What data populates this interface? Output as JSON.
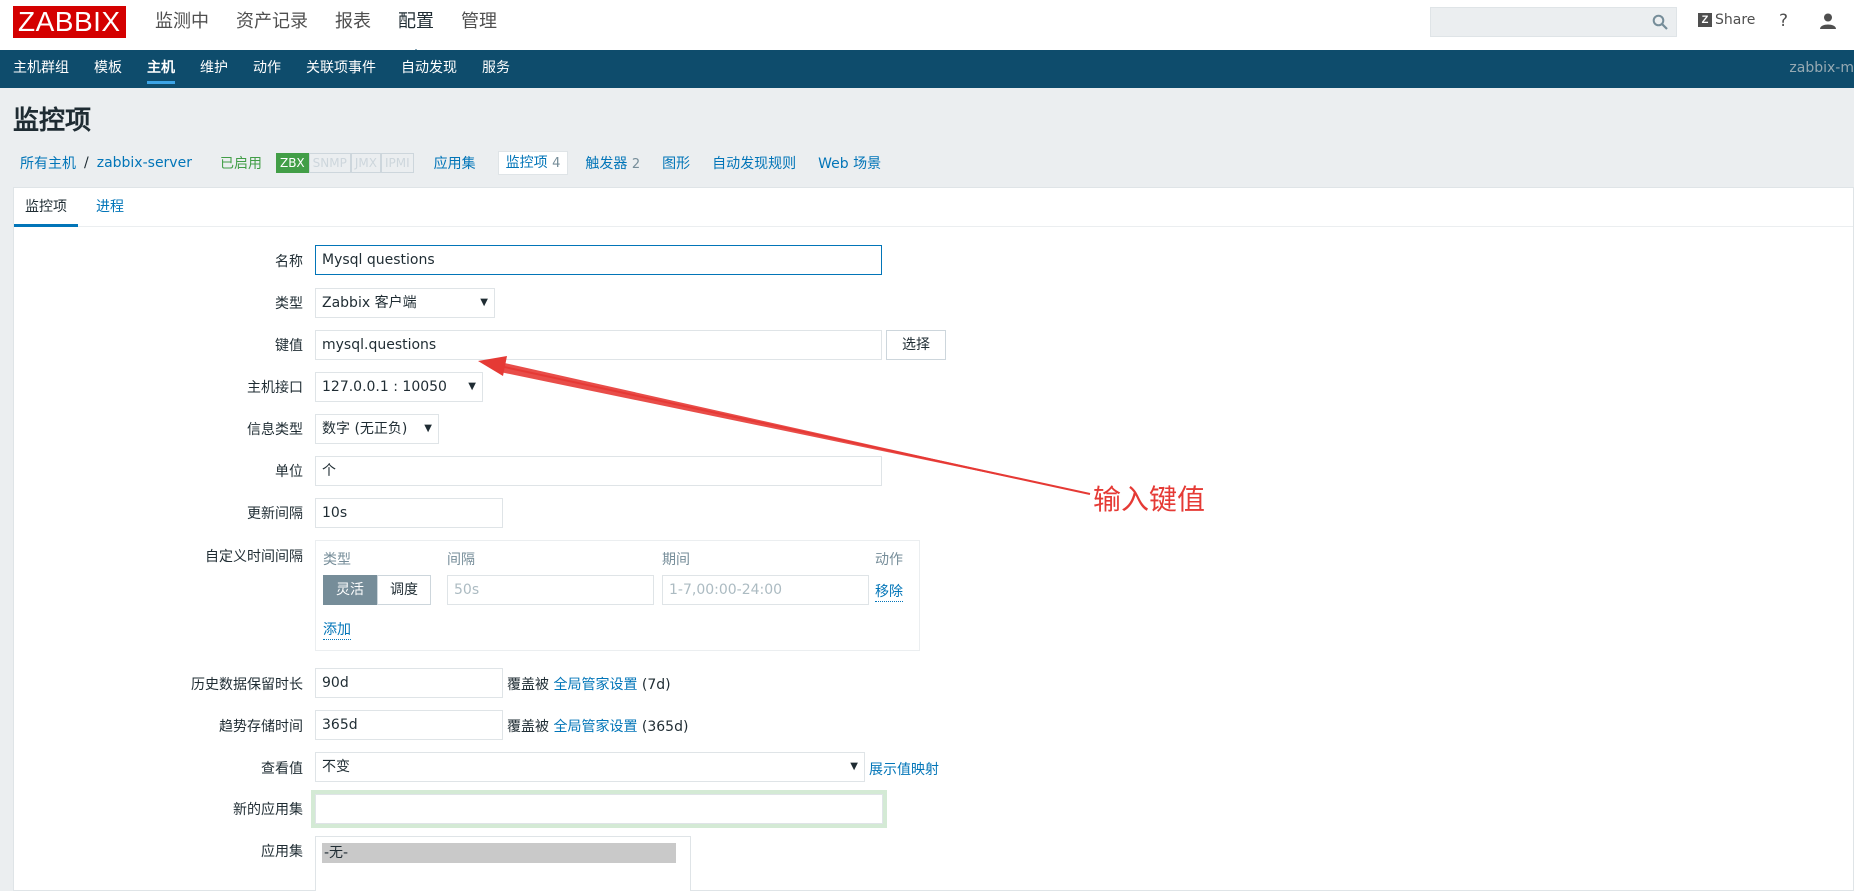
{
  "logo": "ZABBIX",
  "main_menu": [
    "监测中",
    "资产记录",
    "报表",
    "配置",
    "管理"
  ],
  "main_menu_active": "配置",
  "search": {
    "value": ""
  },
  "share": "Share",
  "help": "?",
  "sub_nav": [
    "主机群组",
    "模板",
    "主机",
    "维护",
    "动作",
    "关联项事件",
    "自动发现",
    "服务"
  ],
  "sub_nav_active": "主机",
  "server_label": "zabbix-m",
  "page_title": "监控项",
  "host_nav": {
    "all_hosts": "所有主机",
    "sep": "/",
    "host": "zabbix-server",
    "status": "已启用",
    "availability": [
      "ZBX",
      "SNMP",
      "JMX",
      "IPMI"
    ],
    "links": [
      {
        "label": "应用集",
        "count": ""
      },
      {
        "label": "监控项",
        "count": "4"
      },
      {
        "label": "触发器",
        "count": "2"
      },
      {
        "label": "图形",
        "count": ""
      },
      {
        "label": "自动发现规则",
        "count": ""
      },
      {
        "label": "Web 场景",
        "count": ""
      }
    ]
  },
  "tabs": [
    "监控项",
    "进程"
  ],
  "form": {
    "name_label": "名称",
    "name_value": "Mysql  questions",
    "type_label": "类型",
    "type_value": "Zabbix 客户端",
    "key_label": "键值",
    "key_value": "mysql.questions",
    "select_button": "选择",
    "interface_label": "主机接口",
    "interface_value": "127.0.0.1 : 10050",
    "info_type_label": "信息类型",
    "info_type_value": "数字 (无正负)",
    "units_label": "单位",
    "units_value": "个",
    "interval_label": "更新间隔",
    "interval_value": "10s",
    "custom_label": "自定义时间间隔",
    "custom_headers": {
      "type": "类型",
      "interval": "间隔",
      "period": "期间",
      "action": "动作"
    },
    "custom_flexible": "灵活",
    "custom_scheduling": "调度",
    "custom_interval_placeholder": "50s",
    "custom_period_placeholder": "1-7,00:00-24:00",
    "custom_remove": "移除",
    "custom_add": "添加",
    "history_label": "历史数据保留时长",
    "history_value": "90d",
    "override_prefix": "覆盖被",
    "global_settings": "全局管家设置",
    "history_override_suffix": "(7d)",
    "trends_label": "趋势存储时间",
    "trends_value": "365d",
    "trends_override_suffix": "(365d)",
    "showvalue_label": "查看值",
    "showvalue_value": "不变",
    "showvalue_link": "展示值映射",
    "new_app_label": "新的应用集",
    "new_app_value": "",
    "apps_label": "应用集",
    "apps_option": "-无-"
  },
  "annotation": "输入键值",
  "colors": {
    "brand": "#d40000",
    "nav": "#0e4c6c",
    "link": "#0275b8",
    "annotation": "#e53a35",
    "enabled": "#429e47"
  }
}
